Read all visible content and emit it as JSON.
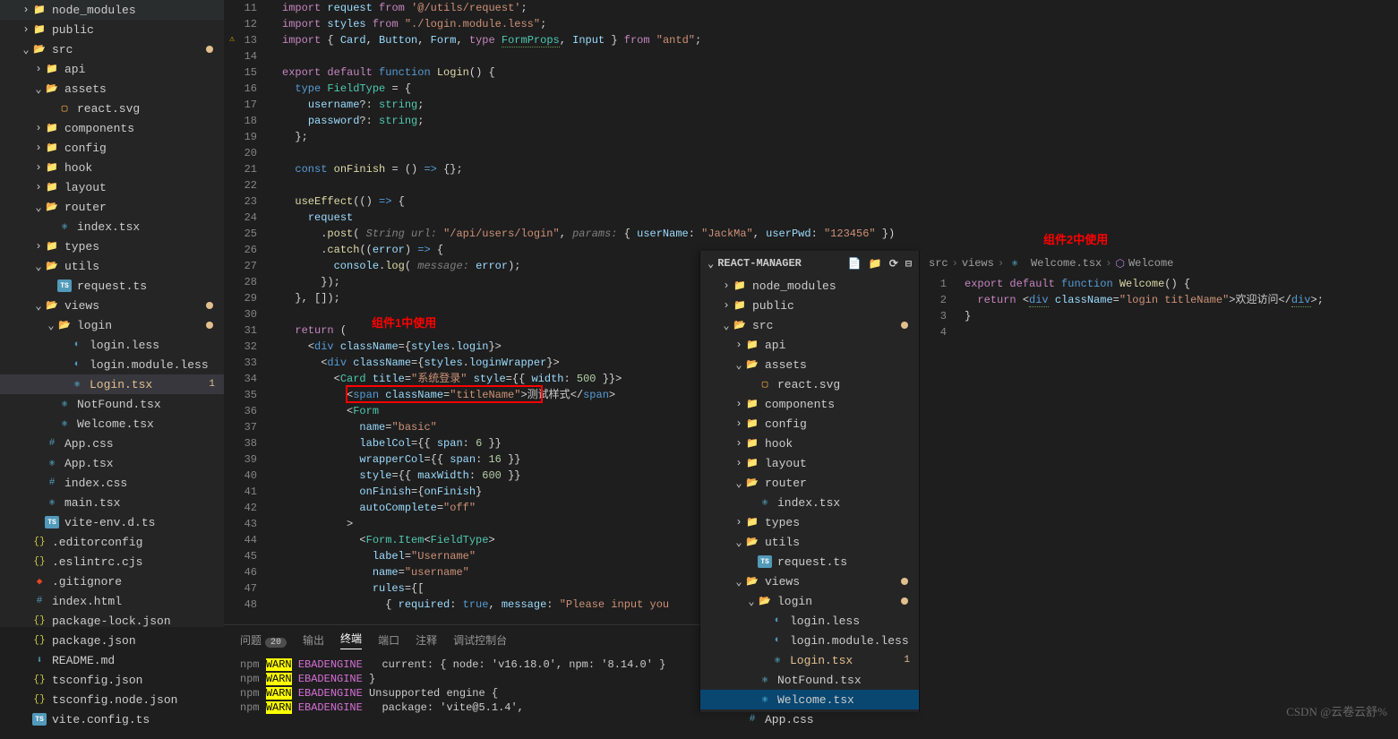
{
  "sidebar1": {
    "items": [
      {
        "indent": 1,
        "twist": "›",
        "ico": "folder",
        "label": "node_modules"
      },
      {
        "indent": 1,
        "twist": "›",
        "ico": "folder",
        "label": "public"
      },
      {
        "indent": 1,
        "twist": "⌄",
        "ico": "folder-open",
        "label": "src",
        "dot": true
      },
      {
        "indent": 2,
        "twist": "›",
        "ico": "folder",
        "label": "api"
      },
      {
        "indent": 2,
        "twist": "⌄",
        "ico": "folder-open",
        "label": "assets"
      },
      {
        "indent": 3,
        "twist": "",
        "ico": "svg",
        "label": "react.svg"
      },
      {
        "indent": 2,
        "twist": "›",
        "ico": "folder",
        "label": "components"
      },
      {
        "indent": 2,
        "twist": "›",
        "ico": "folder",
        "label": "config"
      },
      {
        "indent": 2,
        "twist": "›",
        "ico": "folder",
        "label": "hook"
      },
      {
        "indent": 2,
        "twist": "›",
        "ico": "folder",
        "label": "layout"
      },
      {
        "indent": 2,
        "twist": "⌄",
        "ico": "folder-open",
        "label": "router"
      },
      {
        "indent": 3,
        "twist": "",
        "ico": "react",
        "label": "index.tsx"
      },
      {
        "indent": 2,
        "twist": "›",
        "ico": "folder",
        "label": "types"
      },
      {
        "indent": 2,
        "twist": "⌄",
        "ico": "folder-open",
        "label": "utils"
      },
      {
        "indent": 3,
        "twist": "",
        "ico": "ts",
        "label": "request.ts"
      },
      {
        "indent": 2,
        "twist": "⌄",
        "ico": "folder-open",
        "label": "views",
        "dot": true
      },
      {
        "indent": 3,
        "twist": "⌄",
        "ico": "folder-open",
        "label": "login",
        "dot": true
      },
      {
        "indent": 4,
        "twist": "",
        "ico": "less",
        "label": "login.less"
      },
      {
        "indent": 4,
        "twist": "",
        "ico": "less",
        "label": "login.module.less"
      },
      {
        "indent": 4,
        "twist": "",
        "ico": "react",
        "label": "Login.tsx",
        "mod": true,
        "badge": "1",
        "selected": true
      },
      {
        "indent": 3,
        "twist": "",
        "ico": "react",
        "label": "NotFound.tsx"
      },
      {
        "indent": 3,
        "twist": "",
        "ico": "react",
        "label": "Welcome.tsx"
      },
      {
        "indent": 2,
        "twist": "",
        "ico": "css",
        "label": "App.css"
      },
      {
        "indent": 2,
        "twist": "",
        "ico": "react",
        "label": "App.tsx"
      },
      {
        "indent": 2,
        "twist": "",
        "ico": "css",
        "label": "index.css"
      },
      {
        "indent": 2,
        "twist": "",
        "ico": "react",
        "label": "main.tsx"
      },
      {
        "indent": 2,
        "twist": "",
        "ico": "ts",
        "label": "vite-env.d.ts"
      },
      {
        "indent": 1,
        "twist": "",
        "ico": "json",
        "label": ".editorconfig"
      },
      {
        "indent": 1,
        "twist": "",
        "ico": "json",
        "label": ".eslintrc.cjs"
      },
      {
        "indent": 1,
        "twist": "",
        "ico": "git",
        "label": ".gitignore"
      },
      {
        "indent": 1,
        "twist": "",
        "ico": "css",
        "label": "index.html"
      },
      {
        "indent": 1,
        "twist": "",
        "ico": "json",
        "label": "package-lock.json"
      },
      {
        "indent": 1,
        "twist": "",
        "ico": "json",
        "label": "package.json"
      },
      {
        "indent": 1,
        "twist": "",
        "ico": "md",
        "label": "README.md"
      },
      {
        "indent": 1,
        "twist": "",
        "ico": "json",
        "label": "tsconfig.json"
      },
      {
        "indent": 1,
        "twist": "",
        "ico": "json",
        "label": "tsconfig.node.json"
      },
      {
        "indent": 1,
        "twist": "",
        "ico": "ts",
        "label": "vite.config.ts"
      }
    ]
  },
  "editor1": {
    "lines": [
      {
        "n": 11,
        "html": "<span class='k'>import</span> <span class='va'>request</span> <span class='k'>from</span> <span class='st'>'@/utils/request'</span><span class='pn'>;</span>"
      },
      {
        "n": 12,
        "html": "<span class='k'>import</span> <span class='va'>styles</span> <span class='k'>from</span> <span class='st'>\"./login.module.less\"</span><span class='pn'>;</span>"
      },
      {
        "n": 13,
        "warn": true,
        "html": "<span class='k'>import</span> <span class='pn'>{ </span><span class='va'>Card</span><span class='pn'>, </span><span class='va'>Button</span><span class='pn'>, </span><span class='va'>Form</span><span class='pn'>, </span><span class='k'>type</span> <span class='ty dotted'>FormProps</span><span class='pn'>, </span><span class='va'>Input</span><span class='pn'> } </span><span class='k'>from</span> <span class='st'>\"antd\"</span><span class='pn'>;</span>"
      },
      {
        "n": 14,
        "html": ""
      },
      {
        "n": 15,
        "html": "<span class='k'>export</span> <span class='k'>default</span> <span class='bl'>function</span> <span class='fn'>Login</span><span class='pn'>() {</span>"
      },
      {
        "n": 16,
        "html": "  <span class='bl'>type</span> <span class='ty'>FieldType</span> <span class='pn'>= {</span>"
      },
      {
        "n": 17,
        "html": "    <span class='va'>username</span><span class='pn'>?:</span> <span class='ty'>string</span><span class='pn'>;</span>"
      },
      {
        "n": 18,
        "html": "    <span class='va'>password</span><span class='pn'>?:</span> <span class='ty'>string</span><span class='pn'>;</span>"
      },
      {
        "n": 19,
        "html": "  <span class='pn'>};</span>"
      },
      {
        "n": 20,
        "html": ""
      },
      {
        "n": 21,
        "html": "  <span class='bl'>const</span> <span class='fn'>onFinish</span> <span class='pn'>= () </span><span class='bl'>=></span> <span class='pn'>{};</span>"
      },
      {
        "n": 22,
        "html": ""
      },
      {
        "n": 23,
        "html": "  <span class='fn'>useEffect</span><span class='pn'>(() </span><span class='bl'>=></span> <span class='pn'>{</span>"
      },
      {
        "n": 24,
        "html": "    <span class='va'>request</span>"
      },
      {
        "n": 25,
        "html": "      <span class='pn'>.</span><span class='fn'>post</span><span class='pn'>( </span><span class='pa'>String url:</span> <span class='st'>\"/api/users/login\"</span><span class='pn'>, </span><span class='pa'>params:</span> <span class='pn'>{ </span><span class='va'>userName</span><span class='pn'>: </span><span class='st'>\"JackMa\"</span><span class='pn'>, </span><span class='va'>userPwd</span><span class='pn'>: </span><span class='st'>\"123456\"</span><span class='pn'> })</span>"
      },
      {
        "n": 26,
        "html": "      <span class='pn'>.</span><span class='fn'>catch</span><span class='pn'>((</span><span class='va'>error</span><span class='pn'>) </span><span class='bl'>=></span> <span class='pn'>{</span>"
      },
      {
        "n": 27,
        "html": "        <span class='va'>console</span><span class='pn'>.</span><span class='fn'>log</span><span class='pn'>( </span><span class='pa'>message:</span> <span class='va'>error</span><span class='pn'>);</span>"
      },
      {
        "n": 28,
        "html": "      <span class='pn'>});</span>"
      },
      {
        "n": 29,
        "html": "  <span class='pn'>}, []);</span>"
      },
      {
        "n": 30,
        "html": ""
      },
      {
        "n": 31,
        "html": "  <span class='k'>return</span> <span class='pn'>(</span>"
      },
      {
        "n": 32,
        "html": "    <span class='pn'>&lt;</span><span class='bl'>div</span> <span class='at'>className</span><span class='pn'>={</span><span class='va'>styles</span><span class='pn'>.</span><span class='va'>login</span><span class='pn'>}&gt;</span>"
      },
      {
        "n": 33,
        "html": "      <span class='pn'>&lt;</span><span class='bl'>div</span> <span class='at'>className</span><span class='pn'>={</span><span class='va'>styles</span><span class='pn'>.</span><span class='va'>loginWrapper</span><span class='pn'>}&gt;</span>"
      },
      {
        "n": 34,
        "html": "        <span class='pn'>&lt;</span><span class='tg'>Card</span> <span class='at'>title</span><span class='pn'>=</span><span class='st'>\"系统登录\"</span> <span class='at'>style</span><span class='pn'>={{ </span><span class='va'>width</span><span class='pn'>: </span><span class='nm'>500</span><span class='pn'> }}&gt;</span>"
      },
      {
        "n": 35,
        "html": "          <span class='pn'>&lt;</span><span class='bl'>span</span> <span class='at'>className</span><span class='pn'>=</span><span class='st'>\"titleName\"</span><span class='pn'>&gt;</span>测试样式<span class='pn'>&lt;/</span><span class='bl'>span</span><span class='pn'>&gt;</span>"
      },
      {
        "n": 36,
        "html": "          <span class='pn'>&lt;</span><span class='tg'>Form</span>"
      },
      {
        "n": 37,
        "html": "            <span class='at'>name</span><span class='pn'>=</span><span class='st'>\"basic\"</span>"
      },
      {
        "n": 38,
        "html": "            <span class='at'>labelCol</span><span class='pn'>={{ </span><span class='va'>span</span><span class='pn'>: </span><span class='nm'>6</span><span class='pn'> }}</span>"
      },
      {
        "n": 39,
        "html": "            <span class='at'>wrapperCol</span><span class='pn'>={{ </span><span class='va'>span</span><span class='pn'>: </span><span class='nm'>16</span><span class='pn'> }}</span>"
      },
      {
        "n": 40,
        "html": "            <span class='at'>style</span><span class='pn'>={{ </span><span class='va'>maxWidth</span><span class='pn'>: </span><span class='nm'>600</span><span class='pn'> }}</span>"
      },
      {
        "n": 41,
        "html": "            <span class='at'>onFinish</span><span class='pn'>={</span><span class='va'>onFinish</span><span class='pn'>}</span>"
      },
      {
        "n": 42,
        "html": "            <span class='at'>autoComplete</span><span class='pn'>=</span><span class='st'>\"off\"</span>"
      },
      {
        "n": 43,
        "html": "          <span class='pn'>&gt;</span>"
      },
      {
        "n": 44,
        "html": "            <span class='pn'>&lt;</span><span class='tg'>Form.Item</span><span class='pn'>&lt;</span><span class='ty'>FieldType</span><span class='pn'>&gt;</span>"
      },
      {
        "n": 45,
        "html": "              <span class='at'>label</span><span class='pn'>=</span><span class='st'>\"Username\"</span>"
      },
      {
        "n": 46,
        "html": "              <span class='at'>name</span><span class='pn'>=</span><span class='st'>\"username\"</span>"
      },
      {
        "n": 47,
        "html": "              <span class='at'>rules</span><span class='pn'>={[</span>"
      },
      {
        "n": 48,
        "html": "                <span class='pn'>{ </span><span class='va'>required</span><span class='pn'>: </span><span class='bl'>true</span><span class='pn'>, </span><span class='va'>message</span><span class='pn'>: </span><span class='st'>\"Please input you</span>"
      }
    ]
  },
  "notes": {
    "n1": "组件1中使用",
    "n2": "组件2中使用"
  },
  "terminal": {
    "tabs": [
      "问题",
      "输出",
      "终端",
      "端口",
      "注释",
      "调试控制台"
    ],
    "badge": "20",
    "lines": [
      {
        "pre": "npm ",
        "tag": "WARN",
        "code": " EBADENGINE",
        "rest": "   current: { node: 'v16.18.0', npm: '8.14.0' }"
      },
      {
        "pre": "npm ",
        "tag": "WARN",
        "code": " EBADENGINE",
        "rest": " }"
      },
      {
        "pre": "npm ",
        "tag": "WARN",
        "code": " EBADENGINE",
        "rest": " Unsupported engine {"
      },
      {
        "pre": "npm ",
        "tag": "WARN",
        "code": " EBADENGINE",
        "rest": "   package: 'vite@5.1.4',"
      }
    ]
  },
  "panel2": {
    "title": "REACT-MANAGER",
    "items": [
      {
        "indent": 1,
        "twist": "›",
        "ico": "folder",
        "label": "node_modules"
      },
      {
        "indent": 1,
        "twist": "›",
        "ico": "folder",
        "label": "public"
      },
      {
        "indent": 1,
        "twist": "⌄",
        "ico": "folder-open",
        "label": "src",
        "dot": true
      },
      {
        "indent": 2,
        "twist": "›",
        "ico": "folder",
        "label": "api"
      },
      {
        "indent": 2,
        "twist": "⌄",
        "ico": "folder-open",
        "label": "assets"
      },
      {
        "indent": 3,
        "twist": "",
        "ico": "svg",
        "label": "react.svg"
      },
      {
        "indent": 2,
        "twist": "›",
        "ico": "folder",
        "label": "components"
      },
      {
        "indent": 2,
        "twist": "›",
        "ico": "folder",
        "label": "config"
      },
      {
        "indent": 2,
        "twist": "›",
        "ico": "folder",
        "label": "hook"
      },
      {
        "indent": 2,
        "twist": "›",
        "ico": "folder",
        "label": "layout"
      },
      {
        "indent": 2,
        "twist": "⌄",
        "ico": "folder-open",
        "label": "router"
      },
      {
        "indent": 3,
        "twist": "",
        "ico": "react",
        "label": "index.tsx"
      },
      {
        "indent": 2,
        "twist": "›",
        "ico": "folder",
        "label": "types"
      },
      {
        "indent": 2,
        "twist": "⌄",
        "ico": "folder-open",
        "label": "utils"
      },
      {
        "indent": 3,
        "twist": "",
        "ico": "ts",
        "label": "request.ts"
      },
      {
        "indent": 2,
        "twist": "⌄",
        "ico": "folder-open",
        "label": "views",
        "dot": true
      },
      {
        "indent": 3,
        "twist": "⌄",
        "ico": "folder-open",
        "label": "login",
        "dot": true
      },
      {
        "indent": 4,
        "twist": "",
        "ico": "less",
        "label": "login.less"
      },
      {
        "indent": 4,
        "twist": "",
        "ico": "less",
        "label": "login.module.less"
      },
      {
        "indent": 4,
        "twist": "",
        "ico": "react",
        "label": "Login.tsx",
        "mod": true,
        "badge": "1"
      },
      {
        "indent": 3,
        "twist": "",
        "ico": "react",
        "label": "NotFound.tsx"
      },
      {
        "indent": 3,
        "twist": "",
        "ico": "react",
        "label": "Welcome.tsx",
        "sel": true
      },
      {
        "indent": 2,
        "twist": "",
        "ico": "css",
        "label": "App.css"
      }
    ]
  },
  "editor2": {
    "breadcrumb": [
      "src",
      "views",
      "Welcome.tsx",
      "Welcome"
    ],
    "lines": [
      {
        "n": 1,
        "html": "<span class='k'>export</span> <span class='k'>default</span> <span class='bl'>function</span> <span class='fn'>Welcome</span><span class='pn'>() {</span>"
      },
      {
        "n": 2,
        "html": "  <span class='k'>return</span> <span class='pn'>&lt;</span><span class='bl dotted'>div</span> <span class='at'>className</span><span class='pn'>=</span><span class='st'>\"login titleName\"</span><span class='pn'>&gt;</span>欢迎访问<span class='pn'>&lt;/</span><span class='bl dotted'>div</span><span class='pn'>&gt;;</span>"
      },
      {
        "n": 3,
        "html": "<span class='pn'>}</span>"
      },
      {
        "n": 4,
        "html": ""
      }
    ]
  },
  "watermark": "CSDN @云卷云舒%"
}
